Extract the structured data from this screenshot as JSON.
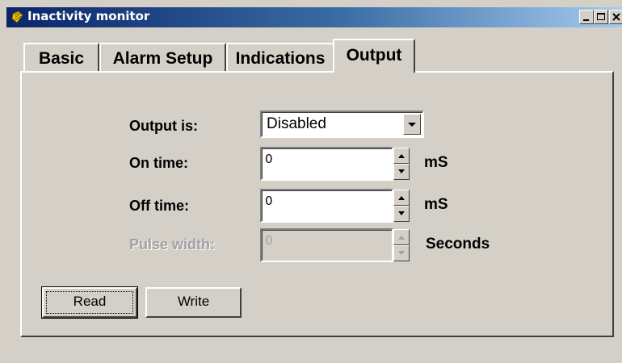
{
  "window": {
    "title": "Inactivity monitor",
    "icons": {
      "app": "app-icon",
      "minimize": "minimize-icon",
      "maximize": "maximize-icon",
      "close": "close-icon"
    }
  },
  "tabs": [
    {
      "label": "Basic",
      "active": false
    },
    {
      "label": "Alarm Setup",
      "active": false
    },
    {
      "label": "Indications",
      "active": false
    },
    {
      "label": "Output",
      "active": true
    }
  ],
  "form": {
    "output_is": {
      "label": "Output is:",
      "value": "Disabled"
    },
    "on_time": {
      "label": "On time:",
      "value": "0",
      "unit": "mS"
    },
    "off_time": {
      "label": "Off time:",
      "value": "0",
      "unit": "mS"
    },
    "pulse_width": {
      "label": "Pulse width:",
      "value": "0",
      "unit": "Seconds",
      "disabled": true
    }
  },
  "buttons": {
    "read": "Read",
    "write": "Write"
  }
}
